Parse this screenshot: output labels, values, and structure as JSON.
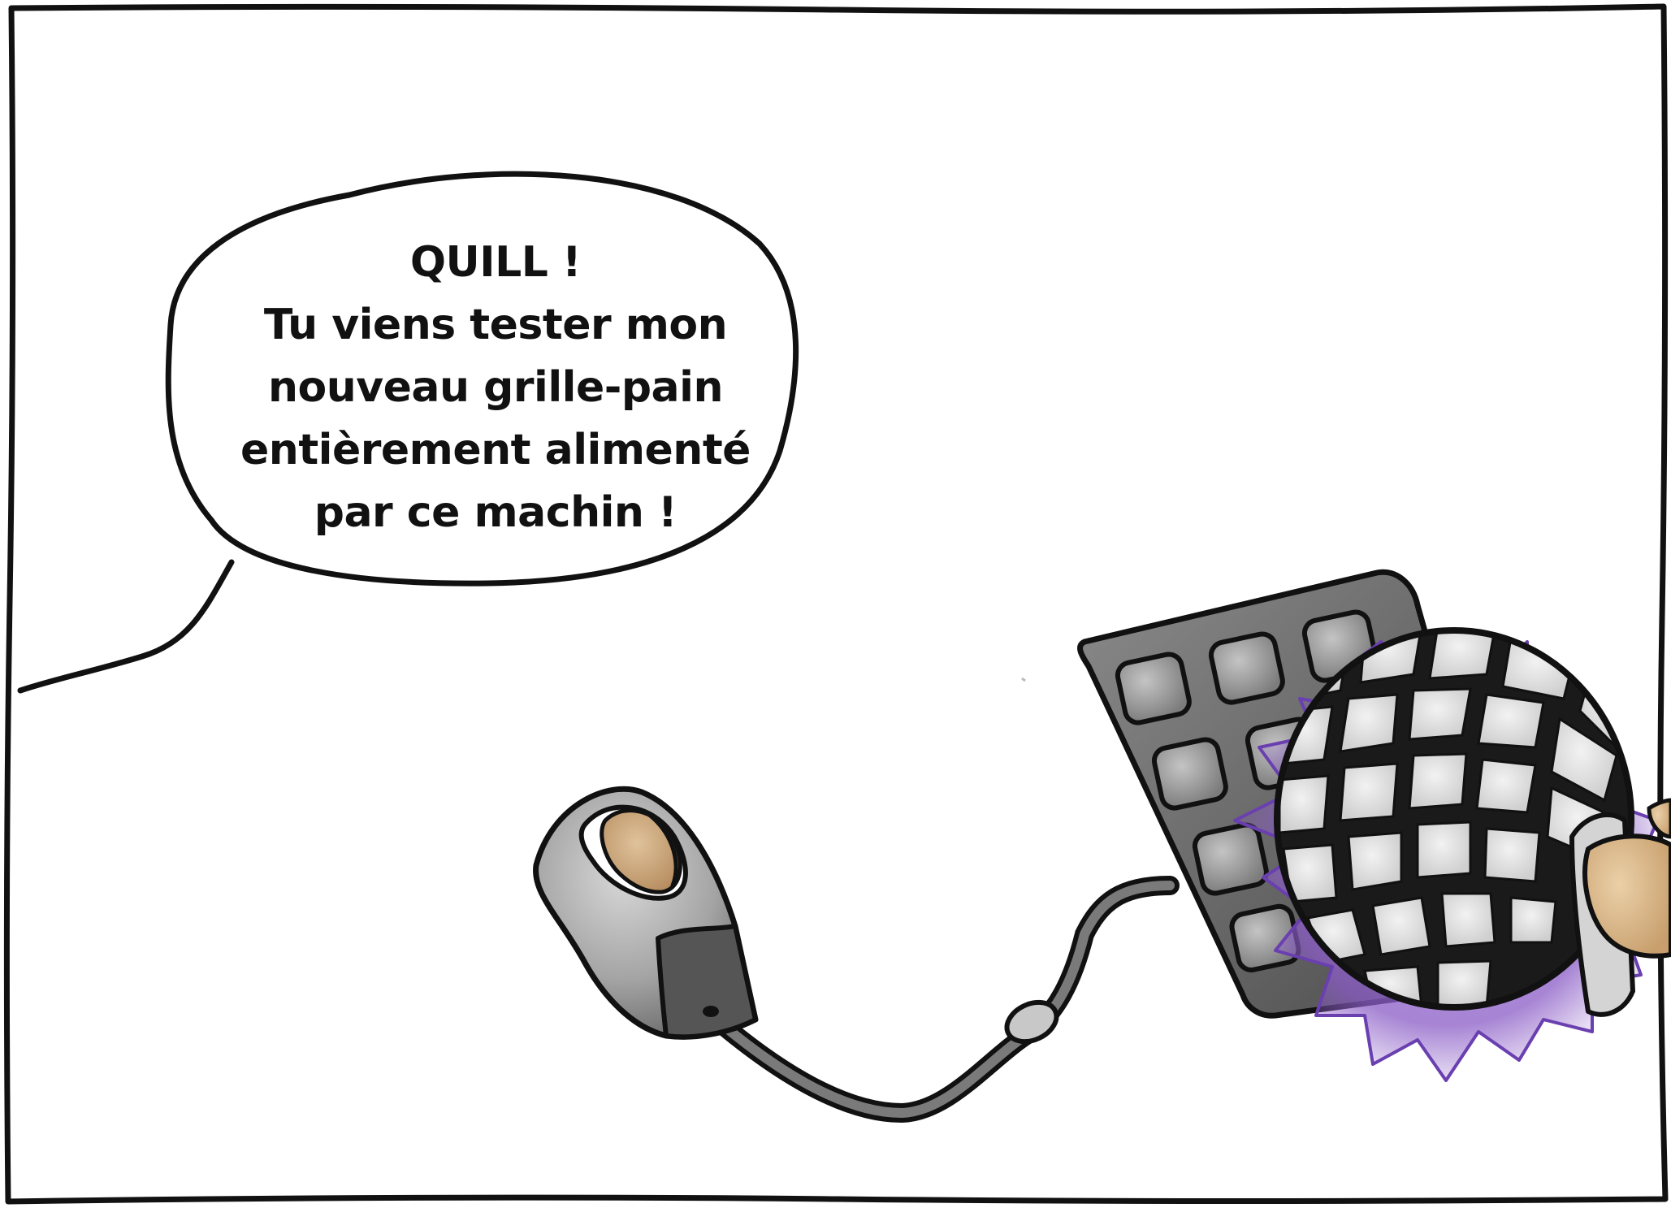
{
  "speech_bubble": {
    "lines": [
      "QUILL !",
      "Tu viens tester mon",
      "nouveau grille-pain",
      "entièrement alimenté",
      "par ce machin !"
    ]
  },
  "colors": {
    "ink": "#111111",
    "background": "#ffffff",
    "toaster_gray": "#8f8f8f",
    "toast_brown": "#c9a27a",
    "panel_gray": "#6e6e6e",
    "glow_purple": "#8a5cc6",
    "hand_skin": "#d9b486"
  }
}
